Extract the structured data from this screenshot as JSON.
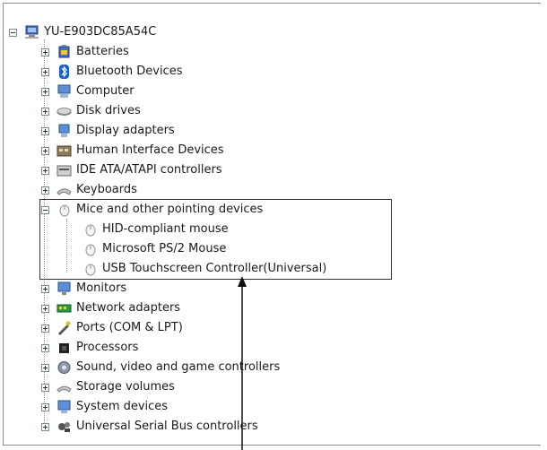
{
  "tree": {
    "root": {
      "label": "YU-E903DC85A54C",
      "icon": "computer-icon"
    },
    "categories_top": [
      {
        "label": "Batteries",
        "icon": "battery-icon"
      },
      {
        "label": "Bluetooth Devices",
        "icon": "bluetooth-icon"
      },
      {
        "label": "Computer",
        "icon": "computer-category-icon"
      },
      {
        "label": "Disk drives",
        "icon": "disk-drive-icon"
      },
      {
        "label": "Display adapters",
        "icon": "display-adapter-icon"
      },
      {
        "label": "Human Interface Devices",
        "icon": "hid-icon"
      },
      {
        "label": "IDE ATA/ATAPI controllers",
        "icon": "ide-controller-icon"
      },
      {
        "label": "Keyboards",
        "icon": "keyboard-icon"
      }
    ],
    "expanded_category": {
      "label": "Mice and other pointing devices",
      "icon": "mouse-icon",
      "children": [
        {
          "label": "HID-compliant mouse",
          "icon": "mouse-icon"
        },
        {
          "label": "Microsoft PS/2 Mouse",
          "icon": "mouse-icon"
        },
        {
          "label": "USB Touchscreen Controller(Universal)",
          "icon": "mouse-icon"
        }
      ]
    },
    "categories_bottom": [
      {
        "label": "Monitors",
        "icon": "monitor-icon"
      },
      {
        "label": "Network adapters",
        "icon": "network-adapter-icon"
      },
      {
        "label": "Ports (COM & LPT)",
        "icon": "port-icon"
      },
      {
        "label": "Processors",
        "icon": "processor-icon"
      },
      {
        "label": "Sound, video and game controllers",
        "icon": "sound-icon"
      },
      {
        "label": "Storage volumes",
        "icon": "storage-volume-icon"
      },
      {
        "label": "System devices",
        "icon": "system-device-icon"
      },
      {
        "label": "Universal Serial Bus controllers",
        "icon": "usb-icon"
      }
    ]
  },
  "colors": {
    "highlight_box": "#333333",
    "tree_line": "#9a9a9a",
    "text": "#1a1a1a"
  }
}
